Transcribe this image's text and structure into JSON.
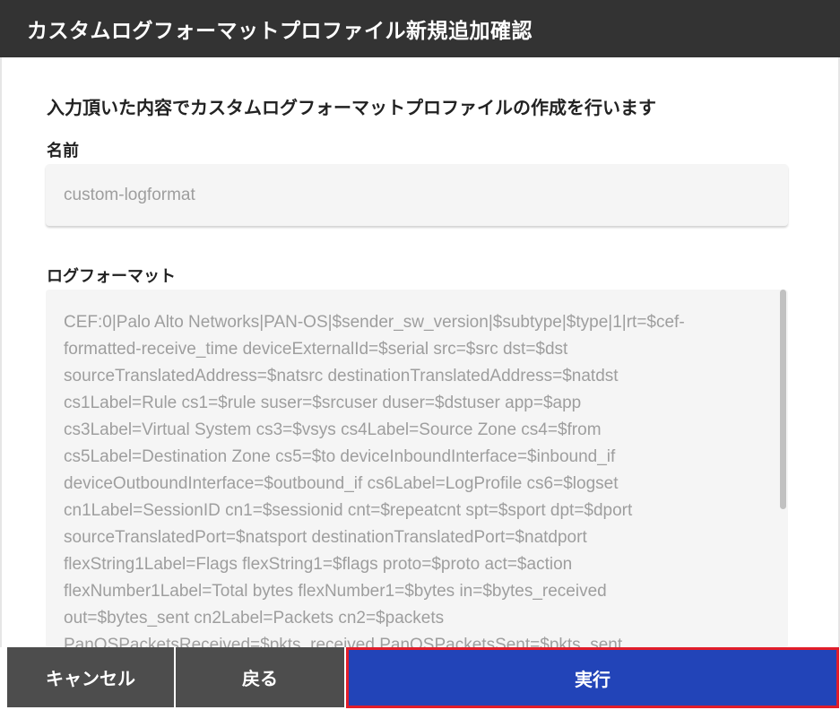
{
  "dialog": {
    "title": "カスタムログフォーマットプロファイル新規追加確認",
    "description": "入力頂いた内容でカスタムログフォーマットプロファイルの作成を行います"
  },
  "name_section": {
    "label": "名前",
    "value": "custom-logformat"
  },
  "log_format_section": {
    "label": "ログフォーマット",
    "lines": [
      "CEF:0|Palo Alto Networks|PAN-OS|$sender_sw_version|$subtype|$type|1|rt=$cef-",
      "formatted-receive_time deviceExternalId=$serial src=$src dst=$dst",
      "sourceTranslatedAddress=$natsrc destinationTranslatedAddress=$natdst",
      "cs1Label=Rule cs1=$rule suser=$srcuser duser=$dstuser app=$app",
      "cs3Label=Virtual System cs3=$vsys cs4Label=Source Zone cs4=$from",
      "cs5Label=Destination Zone cs5=$to deviceInboundInterface=$inbound_if",
      "deviceOutboundInterface=$outbound_if cs6Label=LogProfile cs6=$logset",
      "cn1Label=SessionID cn1=$sessionid cnt=$repeatcnt spt=$sport dpt=$dport",
      "sourceTranslatedPort=$natsport destinationTranslatedPort=$natdport",
      "flexString1Label=Flags flexString1=$flags proto=$proto act=$action",
      "flexNumber1Label=Total bytes flexNumber1=$bytes in=$bytes_received",
      "out=$bytes_sent cn2Label=Packets cn2=$packets",
      "PanOSPacketsReceived=$pkts_received PanOSPacketsSent=$pkts_sent"
    ]
  },
  "footer": {
    "cancel_label": "キャンセル",
    "back_label": "戻る",
    "run_label": "実行"
  },
  "colors": {
    "header_bg": "#333333",
    "primary_button": "#2244b8",
    "secondary_button": "#4d4d4d",
    "highlight_border": "#e11d2a"
  }
}
